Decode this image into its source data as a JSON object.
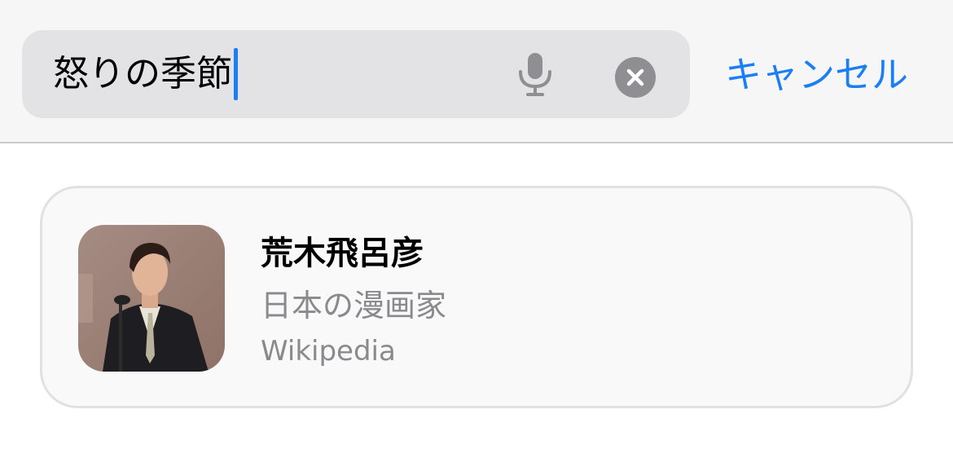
{
  "search": {
    "value": "怒りの季節",
    "cancel_label": "キャンセル",
    "accent_color": "#1a7ef5"
  },
  "icons": {
    "microphone": "mic-icon",
    "clear": "clear-circle-x-icon"
  },
  "result": {
    "title": "荒木飛呂彦",
    "subtitle": "日本の漫画家",
    "source": "Wikipedia",
    "thumbnail": "photo of a man in a dark suit speaking at a microphone"
  }
}
